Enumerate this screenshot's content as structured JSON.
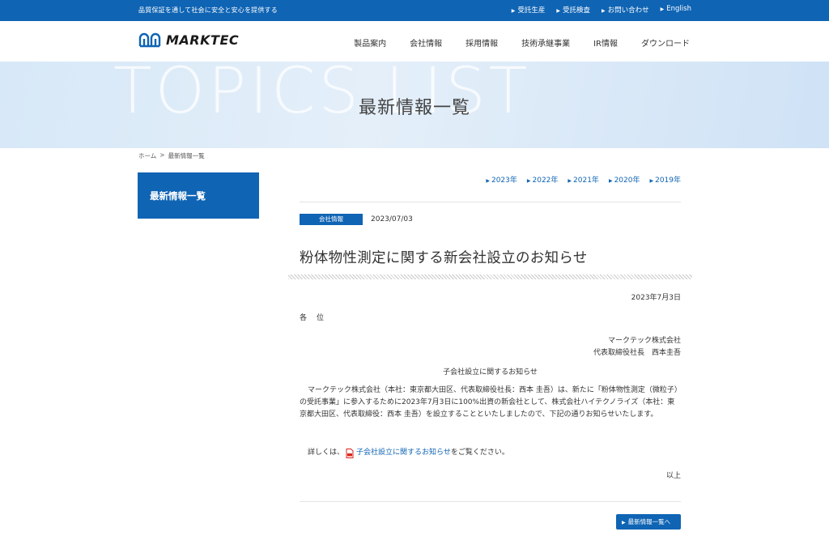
{
  "topbar": {
    "tagline": "品質保証を通して社会に安全と安心を提供する",
    "links": [
      "受託生産",
      "受託検査",
      "お問い合わせ",
      "English"
    ]
  },
  "header": {
    "logo_text": "MARKTEC",
    "nav": [
      "製品案内",
      "会社情報",
      "採用情報",
      "技術承継事業",
      "IR情報",
      "ダウンロード"
    ]
  },
  "hero": {
    "bg_text": "TOPICS LIST",
    "title": "最新情報一覧"
  },
  "breadcrumb": {
    "home": "ホーム",
    "separator": ">",
    "current": "最新情報一覧"
  },
  "sidebar": {
    "title": "最新情報一覧"
  },
  "years": [
    "2023年",
    "2022年",
    "2021年",
    "2020年",
    "2019年"
  ],
  "article": {
    "category": "会社情報",
    "date": "2023/07/03",
    "title": "粉体物性測定に関する新会社設立のお知らせ",
    "doc_date": "2023年7月3日",
    "to": "各位",
    "company": "マークテック株式会社",
    "representative": "代表取締役社長　西本圭吾",
    "subject": "子会社設立に関するお知らせ",
    "paragraph": "マークテック株式会社（本社：東京都大田区、代表取締役社長：西本 圭吾）は、新たに「粉体物性測定（微粒子）の受託事業」に参入するために2023年7月3日に100%出資の新会社として、株式会社ハイテクノライズ（本社：東京都大田区、代表取締役：西本 圭吾）を設立することといたしましたので、下記の通りお知らせいたします。",
    "details_prefix": "詳しくは、",
    "details_link": "子会社設立に関するお知らせ",
    "details_suffix": "をご覧ください。",
    "closing": "以上"
  },
  "back_button": "最新情報一覧へ",
  "colors": {
    "brand_blue": "#0f64b4",
    "pdf_red": "#d9261c"
  }
}
